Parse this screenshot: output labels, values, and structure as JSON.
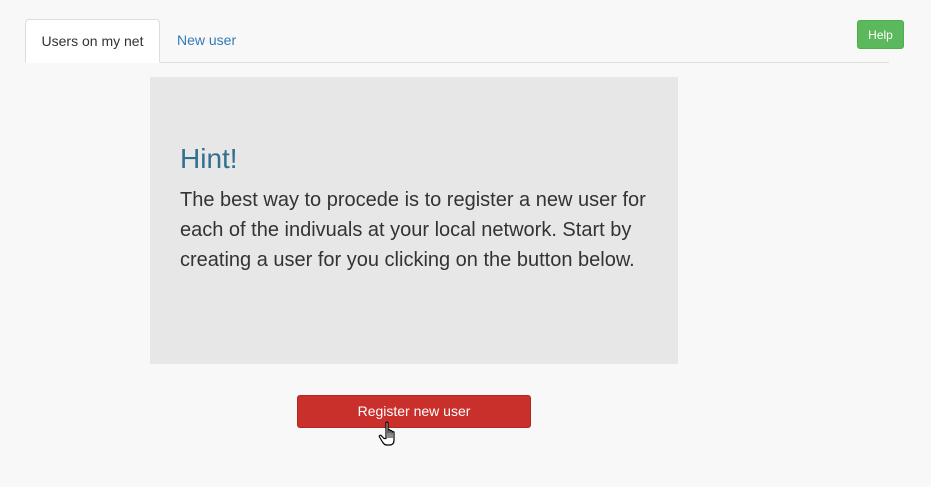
{
  "tabs": {
    "items": [
      {
        "label": "Users on my net",
        "active": true
      },
      {
        "label": "New user",
        "active": false
      }
    ]
  },
  "header": {
    "help_label": "Help"
  },
  "hint": {
    "title": "Hint!",
    "text": "The best way to procede is to register a new user for each of the indivuals at your local network. Start by creating a user for you clicking on the button below."
  },
  "actions": {
    "register_label": "Register new user"
  },
  "colors": {
    "help": "#5cb85c",
    "register": "#c9302c",
    "hint_title": "#31708f",
    "link": "#337ab7",
    "hint_bg": "#e7e7e7"
  },
  "icons": {
    "cursor": "hand-pointer-icon"
  }
}
